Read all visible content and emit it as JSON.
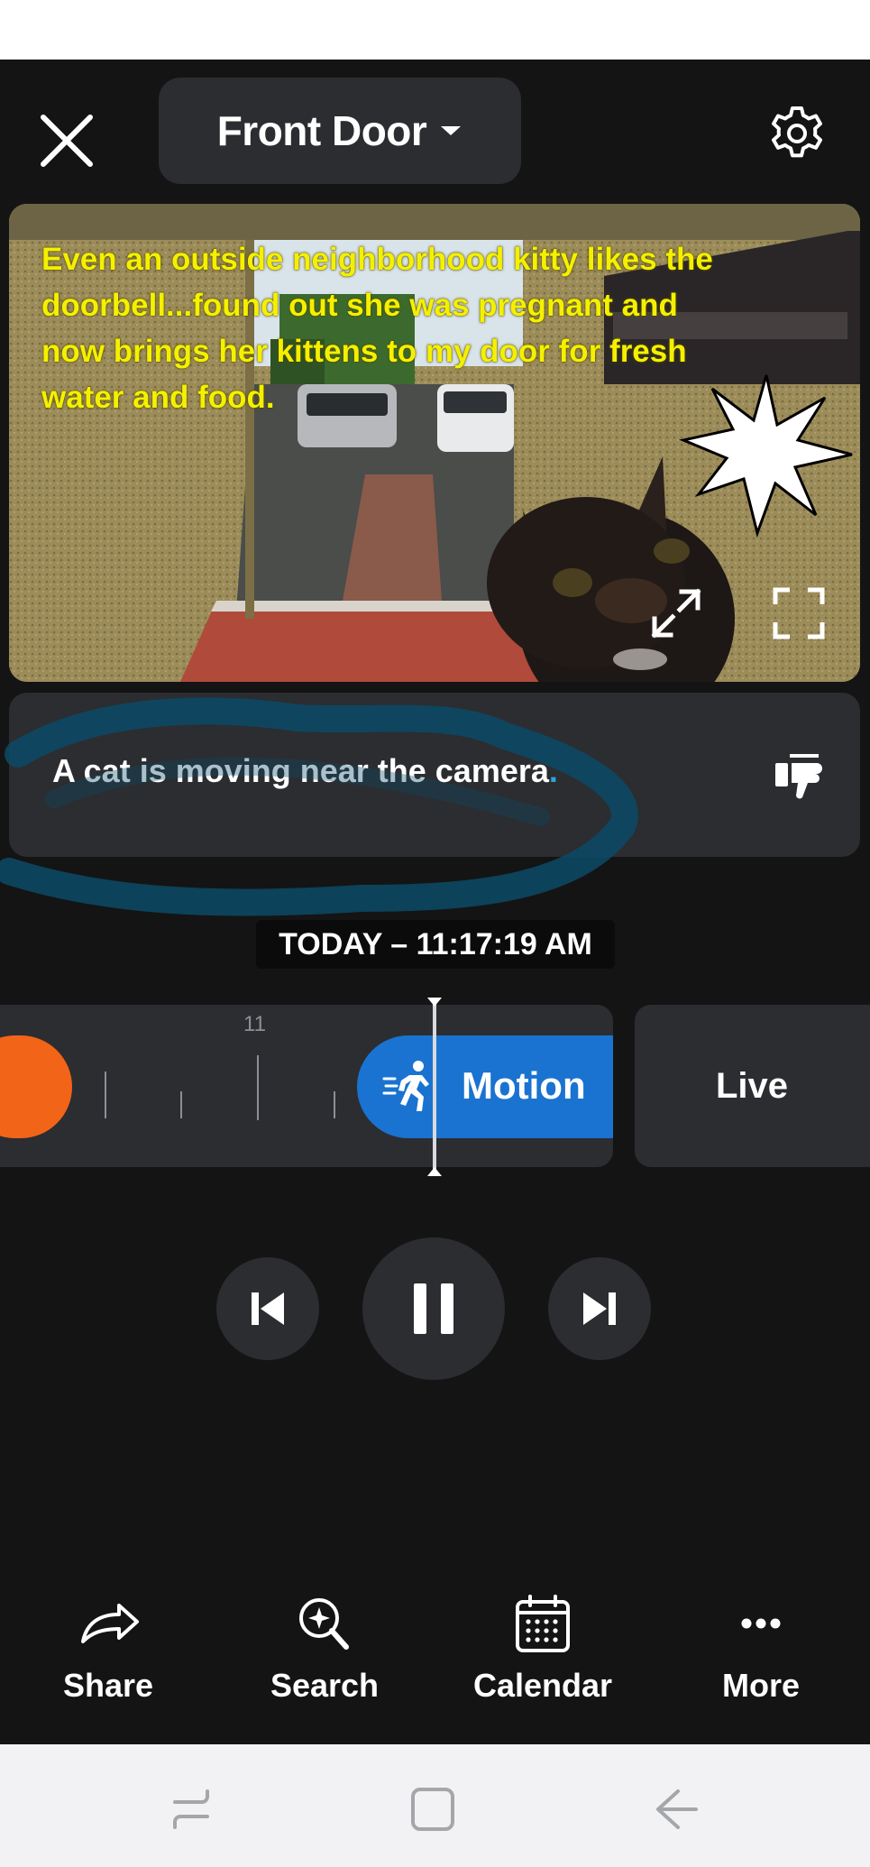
{
  "header": {
    "device_name": "Front Door",
    "close_icon": "close-icon",
    "dropdown_icon": "caret-down-icon",
    "settings_icon": "gear-icon"
  },
  "video": {
    "caption": "Even an outside neighborhood kitty likes the doorbell...found out she was pregnant and now brings her kittens to my door for fresh water and food.",
    "expand_icon": "expand-icon",
    "fullscreen_icon": "fullscreen-icon"
  },
  "description": {
    "text": "A cat is moving near the camera",
    "punctuation": ".",
    "feedback_icon": "thumbs-down-icon"
  },
  "timeline": {
    "timestamp": "TODAY – 11:17:19 AM",
    "hour_label": "11",
    "event_label": "Motion",
    "live_label": "Live"
  },
  "playback": {
    "prev_icon": "skip-previous-icon",
    "pause_icon": "pause-icon",
    "next_icon": "skip-next-icon"
  },
  "actions": [
    {
      "label": "Share",
      "icon": "share-icon"
    },
    {
      "label": "Search",
      "icon": "search-sparkle-icon"
    },
    {
      "label": "Calendar",
      "icon": "calendar-icon"
    },
    {
      "label": "More",
      "icon": "more-icon"
    }
  ],
  "colors": {
    "background": "#141414",
    "card": "#2b2d31",
    "motion_event": "#1a73d0",
    "event_orange": "#f26418",
    "caption_yellow": "#f5f000"
  }
}
